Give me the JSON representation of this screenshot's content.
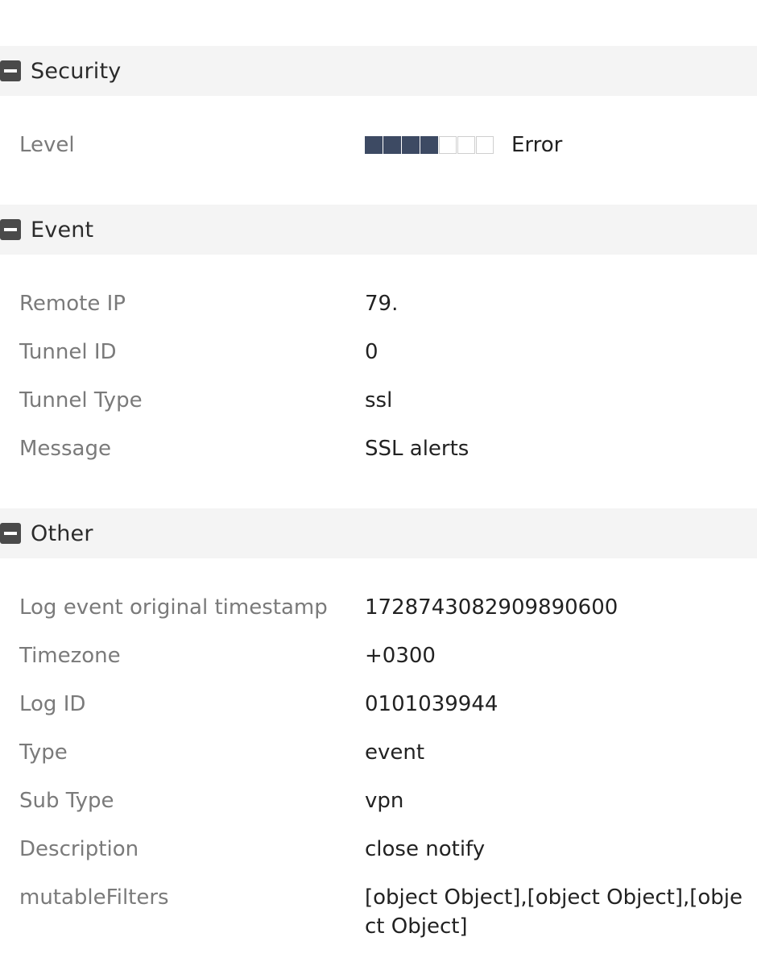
{
  "sections": {
    "security": {
      "title": "Security",
      "level": {
        "label": "Level",
        "value": "Error",
        "filled": 4,
        "total": 7,
        "filled_color": "#3d4a63"
      }
    },
    "event": {
      "title": "Event",
      "rows": [
        {
          "label": "Remote IP",
          "value": "79."
        },
        {
          "label": "Tunnel ID",
          "value": "0"
        },
        {
          "label": "Tunnel Type",
          "value": "ssl"
        },
        {
          "label": "Message",
          "value": "SSL alerts"
        }
      ]
    },
    "other": {
      "title": "Other",
      "rows": [
        {
          "label": "Log event original timestamp",
          "value": "1728743082909890600"
        },
        {
          "label": "Timezone",
          "value": "+0300"
        },
        {
          "label": "Log ID",
          "value": "0101039944"
        },
        {
          "label": "Type",
          "value": "event"
        },
        {
          "label": "Sub Type",
          "value": "vpn"
        },
        {
          "label": "Description",
          "value": "close notify"
        },
        {
          "label": "mutableFilters",
          "value": "[object Object],[object Object],[object Object]"
        }
      ]
    }
  },
  "icons": {
    "collapse": "minus-square-icon"
  }
}
